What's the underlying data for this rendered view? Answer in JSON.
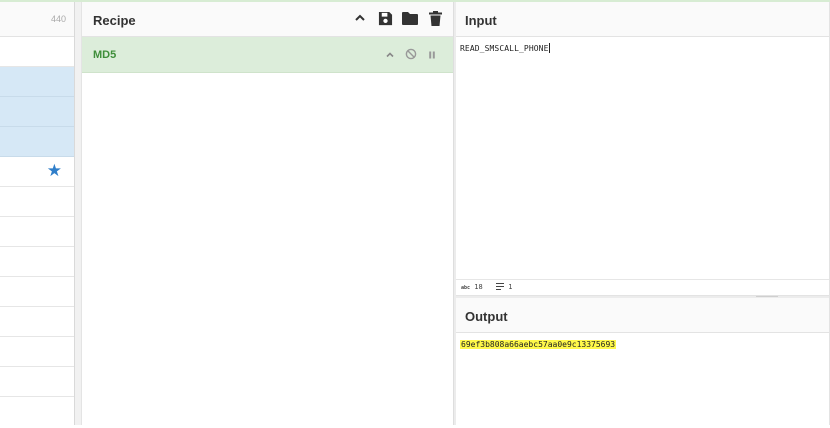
{
  "operations": {
    "count": "440",
    "rows": [
      {
        "selected": false,
        "starred": false
      },
      {
        "selected": true,
        "starred": false
      },
      {
        "selected": true,
        "starred": false
      },
      {
        "selected": true,
        "starred": false
      },
      {
        "selected": false,
        "starred": true
      },
      {
        "selected": false,
        "starred": false
      },
      {
        "selected": false,
        "starred": false
      },
      {
        "selected": false,
        "starred": false
      },
      {
        "selected": false,
        "starred": false
      },
      {
        "selected": false,
        "starred": false
      },
      {
        "selected": false,
        "starred": false
      },
      {
        "selected": false,
        "starred": false
      },
      {
        "selected": false,
        "starred": false
      }
    ],
    "star_icon": "star-icon"
  },
  "recipe": {
    "title": "Recipe",
    "icons": [
      "chevron-up-icon",
      "save-icon",
      "folder-icon",
      "trash-icon"
    ],
    "operation": {
      "name": "MD5",
      "controls": [
        "chevron-up-icon",
        "disable-icon",
        "pause-icon"
      ]
    }
  },
  "input": {
    "title": "Input",
    "text": "READ_SMSCALL_PHONE",
    "status": {
      "length_label": "abc",
      "length": "18",
      "lines_icon": "lines-icon",
      "lines": "1"
    }
  },
  "output": {
    "title": "Output",
    "text": "69ef3b808a66aebc57aa0e9c13375693"
  },
  "colors": {
    "accent_green": "#3f8e3a",
    "operation_bg": "#dcedda",
    "selected_row": "#d6e8f6",
    "star": "#2f7ec9",
    "output_highlight": "#fff94a"
  }
}
